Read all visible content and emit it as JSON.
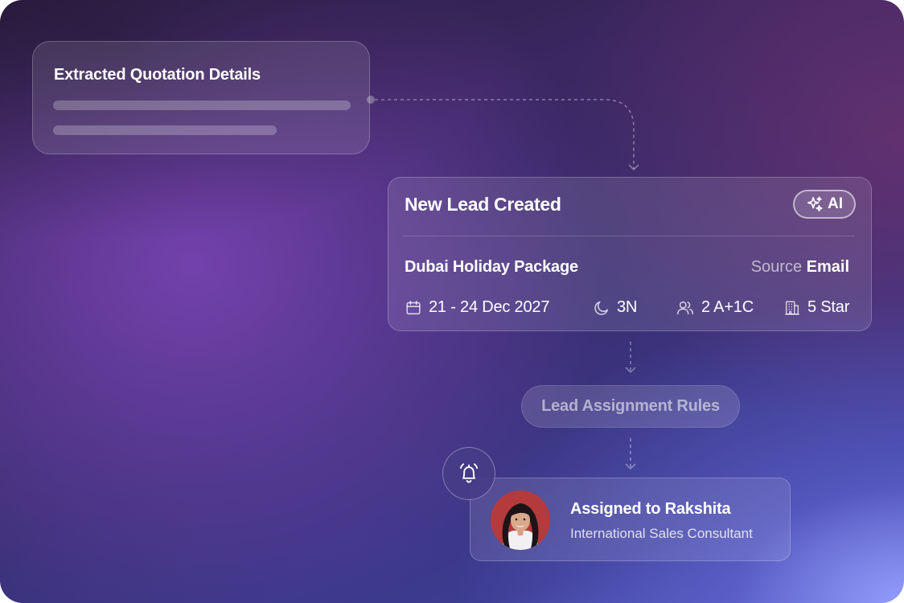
{
  "quotation_card": {
    "title": "Extracted Quotation Details"
  },
  "lead_card": {
    "title": "New Lead Created",
    "ai_badge": {
      "icon": "sparkle-icon",
      "label": "AI"
    },
    "package_name": "Dubai Holiday Package",
    "source_label": "Source",
    "source_value": "Email",
    "meta": {
      "dates": {
        "icon": "calendar-icon",
        "value": "21 - 24 Dec 2027"
      },
      "nights": {
        "icon": "moon-icon",
        "value": "3N"
      },
      "guests": {
        "icon": "users-icon",
        "value": "2 A+1C"
      },
      "hotel": {
        "icon": "building-icon",
        "value": "5 Star"
      }
    }
  },
  "rules_step": {
    "label": "Lead Assignment Rules"
  },
  "assignment_card": {
    "bell_icon": "bell-ringing-icon",
    "name": "Assigned to Rakshita",
    "role": "International Sales Consultant"
  },
  "colors": {
    "background_dark": "#261b39",
    "background_purple": "#3b2761",
    "background_blue": "#5f66c8",
    "avatar_background": "#b53a3c"
  }
}
